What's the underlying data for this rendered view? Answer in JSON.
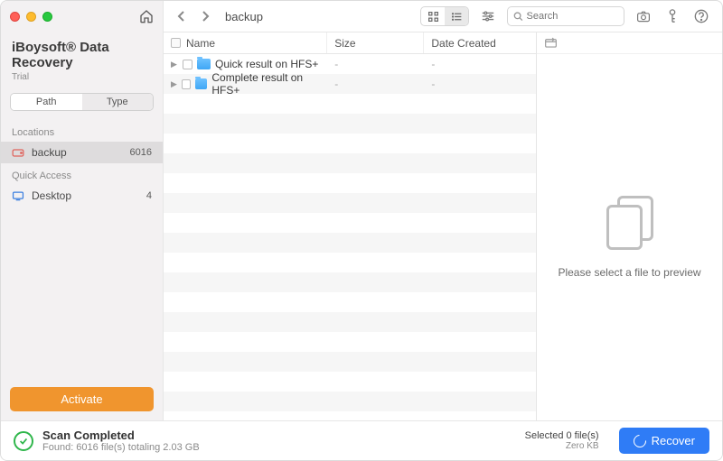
{
  "brand": {
    "title": "iBoysoft® Data Recovery",
    "subtitle": "Trial"
  },
  "sidebar": {
    "tabs": {
      "path": "Path",
      "type": "Type"
    },
    "locations_label": "Locations",
    "locations": [
      {
        "icon": "drive",
        "label": "backup",
        "value": "6016",
        "selected": true
      }
    ],
    "quick_label": "Quick Access",
    "quick": [
      {
        "icon": "desktop",
        "label": "Desktop",
        "value": "4"
      }
    ],
    "activate": "Activate"
  },
  "toolbar": {
    "breadcrumb": "backup",
    "search_placeholder": "Search"
  },
  "table": {
    "headers": {
      "name": "Name",
      "size": "Size",
      "date": "Date Created"
    },
    "rows": [
      {
        "name": "Quick result on HFS+",
        "size": "-",
        "date": "-"
      },
      {
        "name": "Complete result on HFS+",
        "size": "-",
        "date": "-"
      }
    ],
    "blank_rows": 16
  },
  "preview": {
    "message": "Please select a file to preview"
  },
  "footer": {
    "status_title": "Scan Completed",
    "status_detail": "Found: 6016 file(s) totaling 2.03 GB",
    "selected_title": "Selected 0 file(s)",
    "selected_detail": "Zero KB",
    "recover": "Recover"
  }
}
